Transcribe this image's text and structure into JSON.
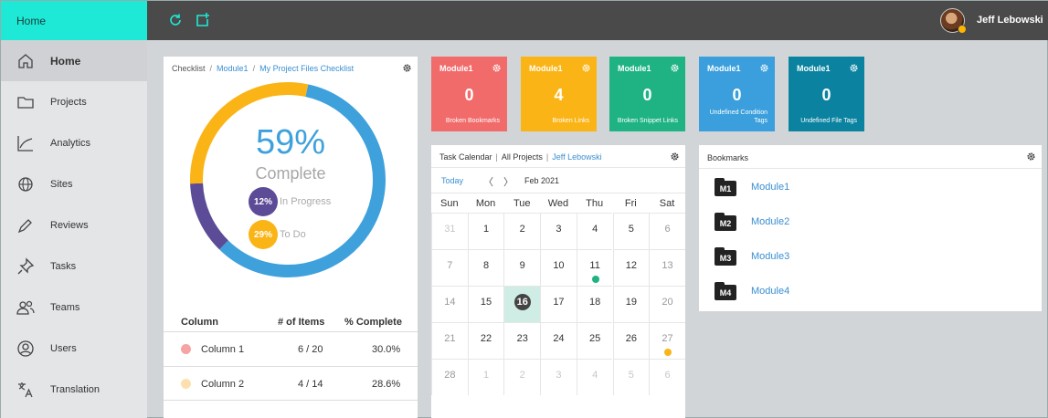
{
  "topbar": {
    "brand": "Home",
    "user_name": "Jeff Lebowski",
    "icons": [
      "refresh-icon",
      "new-window-icon"
    ]
  },
  "sidebar": {
    "items": [
      {
        "label": "Home",
        "icon": "home-icon",
        "active": true
      },
      {
        "label": "Projects",
        "icon": "folder-icon"
      },
      {
        "label": "Analytics",
        "icon": "line-chart-icon"
      },
      {
        "label": "Sites",
        "icon": "globe-icon"
      },
      {
        "label": "Reviews",
        "icon": "pen-icon"
      },
      {
        "label": "Tasks",
        "icon": "pin-icon"
      },
      {
        "label": "Teams",
        "icon": "team-icon"
      },
      {
        "label": "Users",
        "icon": "user-icon"
      },
      {
        "label": "Translation",
        "icon": "translate-icon"
      }
    ]
  },
  "checklist": {
    "breadcrumb": [
      "Checklist",
      "Module1",
      "My Project Files Checklist"
    ],
    "percent": "59%",
    "percent_label": "Complete",
    "in_progress": {
      "value": "12%",
      "label": "In Progress"
    },
    "todo": {
      "value": "29%",
      "label": "To Do"
    },
    "fractions": {
      "complete": 0.59,
      "in_progress": 0.12,
      "todo": 0.29
    },
    "colors": {
      "complete": "#3fa1dc",
      "in_progress": "#5c4b96",
      "todo": "#fbb416"
    },
    "table": {
      "headers": [
        "Column",
        "# of Items",
        "% Complete"
      ],
      "rows": [
        {
          "name": "Column 1",
          "items": "6 / 20",
          "pct": "30.0%",
          "color": "#f5a3a3"
        },
        {
          "name": "Column 2",
          "items": "4 / 14",
          "pct": "28.6%",
          "color": "#fde0b0"
        }
      ]
    }
  },
  "tiles": [
    {
      "title": "Module1",
      "value": "0",
      "label": "Broken Bookmarks",
      "color": "#f16b6b"
    },
    {
      "title": "Module1",
      "value": "4",
      "label": "Broken Links",
      "color": "#fbb416"
    },
    {
      "title": "Module1",
      "value": "0",
      "label": "Broken Snippet Links",
      "color": "#1fb384"
    },
    {
      "title": "Module1",
      "value": "0",
      "label": "Undefined Condition Tags",
      "color": "#3a9fdc"
    },
    {
      "title": "Module1",
      "value": "0",
      "label": "Undefined File Tags",
      "color": "#0b83a0"
    }
  ],
  "calendar": {
    "title": "Task Calendar",
    "scope": "All Projects",
    "user": "Jeff Lebowski",
    "today_label": "Today",
    "prev": "〈",
    "next": "〉",
    "month": "Feb 2021",
    "weekdays": [
      "Sun",
      "Mon",
      "Tue",
      "Wed",
      "Thu",
      "Fri",
      "Sat"
    ],
    "weeks": [
      [
        "31",
        "1",
        "2",
        "3",
        "4",
        "5",
        "6"
      ],
      [
        "7",
        "8",
        "9",
        "10",
        "11",
        "12",
        "13"
      ],
      [
        "14",
        "15",
        "16",
        "17",
        "18",
        "19",
        "20"
      ],
      [
        "21",
        "22",
        "23",
        "24",
        "25",
        "26",
        "27"
      ],
      [
        "28",
        "1",
        "2",
        "3",
        "4",
        "5",
        "6"
      ]
    ],
    "selected_day": "16",
    "event_colors": {
      "11": "#1fb384",
      "27": "#fbb416"
    }
  },
  "bookmarks": {
    "title": "Bookmarks",
    "items": [
      {
        "tag": "M1",
        "label": "Module1"
      },
      {
        "tag": "M2",
        "label": "Module2"
      },
      {
        "tag": "M3",
        "label": "Module3"
      },
      {
        "tag": "M4",
        "label": "Module4"
      }
    ]
  }
}
